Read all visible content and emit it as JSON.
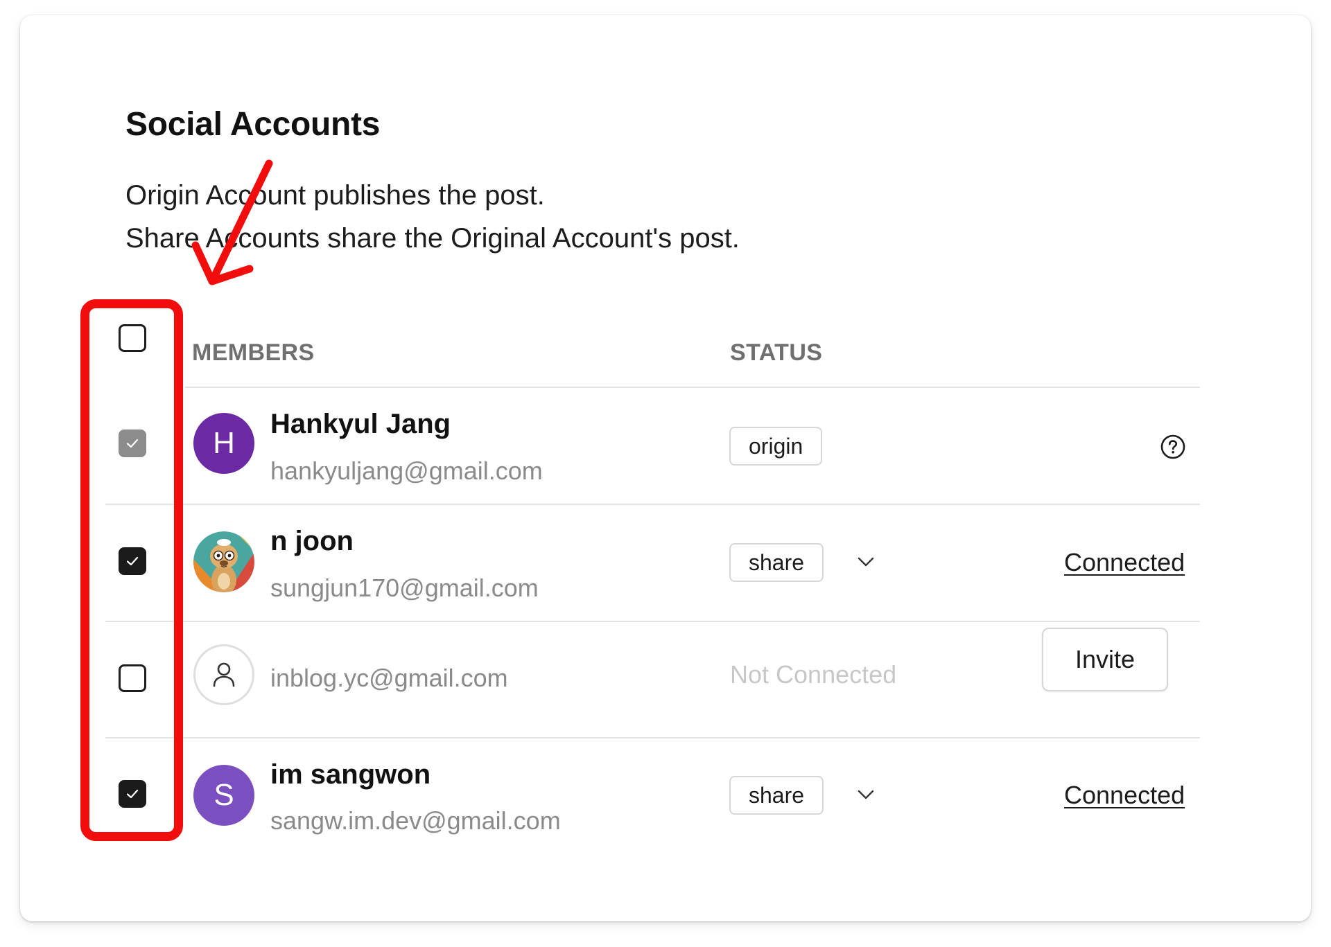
{
  "section": {
    "title": "Social Accounts",
    "description_line1": "Origin Account publishes the post.",
    "description_line2": "Share Accounts share the Original Account's post."
  },
  "table": {
    "columns": {
      "members": "MEMBERS",
      "status": "STATUS"
    },
    "select_all": {
      "checked": false
    },
    "rows": [
      {
        "checked": true,
        "checkbox_state": "disabled",
        "avatar": {
          "type": "initial",
          "letter": "H",
          "color": "#6b2aa3"
        },
        "name": "Hankyul Jang",
        "email": "hankyuljang@gmail.com",
        "role": "origin",
        "role_dropdown": false,
        "right": {
          "type": "help",
          "icon": "question-circle-icon"
        }
      },
      {
        "checked": true,
        "checkbox_state": "checked",
        "avatar": {
          "type": "image",
          "description": "cartoon-meerkat-avatar"
        },
        "name": "n joon",
        "email": "sungjun170@gmail.com",
        "role": "share",
        "role_dropdown": true,
        "right": {
          "type": "link",
          "label": "Connected"
        }
      },
      {
        "checked": false,
        "checkbox_state": "unchecked",
        "avatar": {
          "type": "placeholder",
          "icon": "user-outline-icon"
        },
        "name": "",
        "email": "inblog.yc@gmail.com",
        "status_text": "Not Connected",
        "right": {
          "type": "button",
          "label": "Invite"
        }
      },
      {
        "checked": true,
        "checkbox_state": "checked",
        "avatar": {
          "type": "initial",
          "letter": "S",
          "color": "#7b4fc0"
        },
        "name": "im sangwon",
        "email": "sangw.im.dev@gmail.com",
        "role": "share",
        "role_dropdown": true,
        "right": {
          "type": "link",
          "label": "Connected"
        }
      }
    ]
  },
  "icons": {
    "dropdown": "chevron-down-icon",
    "check": "checkmark-icon",
    "help": "question-circle-icon",
    "user": "user-outline-icon"
  },
  "colors": {
    "annotation": "#f20d0d",
    "avatar_h": "#6b2aa3",
    "avatar_s": "#7b4fc0",
    "checkbox_checked": "#1b1b1b",
    "checkbox_disabled": "#8c8c8c",
    "muted_text": "#8a8a8a"
  }
}
